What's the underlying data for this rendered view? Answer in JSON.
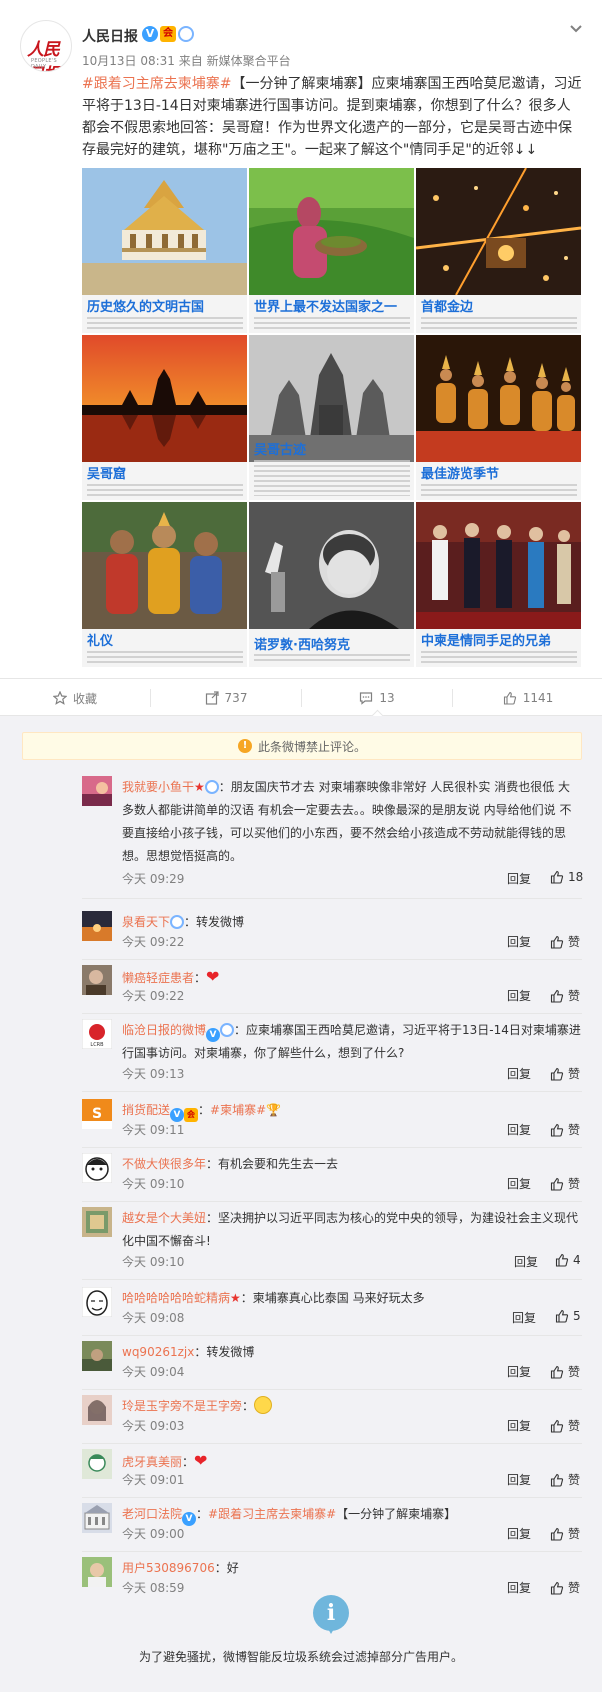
{
  "post": {
    "author": "人民日报",
    "avatar_text": "人民日报",
    "avatar_sub": "PEOPLE'S DAILY",
    "meta": "10月13日 08:31 来自 新媒体聚合平台",
    "topic": "#跟着习主席去柬埔寨#",
    "body": "【一分钟了解柬埔寨】应柬埔寨国王西哈莫尼邀请，习近平将于13日-14日对柬埔寨进行国事访问。提到柬埔寨，你想到了什么？很多人都会不假思索地回答：吴哥窟！作为世界文化遗产的一部分，它是吴哥古迹中保存最完好的建筑，堪称\"万庙之王\"。一起来了解这个\"情同手足\"的近邻↓↓",
    "images": [
      {
        "caption": "历史悠久的文明古国",
        "icon": "palace-photo"
      },
      {
        "caption": "世界上最不发达国家之一",
        "icon": "farmer-photo"
      },
      {
        "caption": "首都金边",
        "icon": "city-night-photo"
      },
      {
        "caption": "吴哥窟",
        "icon": "angkor-sunset-photo"
      },
      {
        "caption": "吴哥古迹",
        "icon": "temple-ruins-photo"
      },
      {
        "caption": "最佳游览季节",
        "icon": "apsara-dancers-photo"
      },
      {
        "caption": "礼仪",
        "icon": "costumed-people-photo"
      },
      {
        "caption": "诺罗敦·西哈努克",
        "icon": "sihanouk-portrait-photo"
      },
      {
        "caption": "中柬是情同手足的兄弟",
        "icon": "state-visit-photo"
      }
    ]
  },
  "toolbar": {
    "favorite": "收藏",
    "repost": "737",
    "comments": "13",
    "likes": "1141"
  },
  "notice": "此条微博禁止评论。",
  "comments": [
    {
      "name": "我就要小鱼干",
      "text": "：朋友国庆节才去 对柬埔寨映像非常好 人民很朴实  消费也很低  大多数人都能讲简单的汉语  有机会一定要去去。。映像最深的是朋友说 内导给他们说 不要直接给小孩子钱，可以买他们的小东西，要不然会给小孩造成不劳动就能得钱的思想。思想觉悟挺高的。",
      "time": "今天 09:29",
      "reply": "回复",
      "likes": "18"
    },
    {
      "name": "泉看天下",
      "text": "：转发微博",
      "time": "今天 09:22",
      "reply": "回复",
      "likes": "赞"
    },
    {
      "name": "懒癌轻症患者",
      "text": "：",
      "time": "今天 09:22",
      "reply": "回复",
      "likes": "赞"
    },
    {
      "name": "临沧日报的微博",
      "text": "：应柬埔寨国王西哈莫尼邀请，习近平将于13日-14日对柬埔寨进行国事访问。对柬埔寨，你了解些什么，想到了什么?",
      "time": "今天 09:13",
      "reply": "回复",
      "likes": "赞"
    },
    {
      "name": "捎货配送",
      "text": "：",
      "topic": "#柬埔寨#",
      "time": "今天 09:11",
      "reply": "回复",
      "likes": "赞"
    },
    {
      "name": "不做大侠很多年",
      "text": "：有机会要和先生去一去",
      "time": "今天 09:10",
      "reply": "回复",
      "likes": "赞"
    },
    {
      "name": "越女是个大美妞",
      "text": "：坚决拥护以习近平同志为核心的党中央的领导，为建设社会主义现代化中国不懈奋斗!",
      "time": "今天 09:10",
      "reply": "回复",
      "likes": "4"
    },
    {
      "name": "哈哈哈哈哈哈蛇精病",
      "text": "：柬埔寨真心比泰国 马来好玩太多",
      "time": "今天 09:08",
      "reply": "回复",
      "likes": "5"
    },
    {
      "name": "wq90261zjx",
      "text": "：转发微博",
      "time": "今天 09:04",
      "reply": "回复",
      "likes": "赞"
    },
    {
      "name": "玲是玉字旁不是王字旁",
      "text": "：",
      "time": "今天 09:03",
      "reply": "回复",
      "likes": "赞"
    },
    {
      "name": "虎牙真美丽",
      "text": "：",
      "time": "今天 09:01",
      "reply": "回复",
      "likes": "赞"
    },
    {
      "name": "老河口法院",
      "text": "：",
      "topic": "#跟着习主席去柬埔寨#",
      "text2": "【一分钟了解柬埔寨】",
      "time": "今天 09:00",
      "reply": "回复",
      "likes": "赞"
    },
    {
      "name": "用户530896706",
      "text": "：好",
      "time": "今天 08:59",
      "reply": "回复",
      "likes": "赞"
    }
  ],
  "footer": "为了避免骚扰，微博智能反垃圾系统会过滤掉部分广告用户。",
  "colors": {
    "link": "#eb7350",
    "caption": "#1d6fd8",
    "notice_bg": "#fffbe6",
    "page_bg": "#f2f2f5"
  }
}
